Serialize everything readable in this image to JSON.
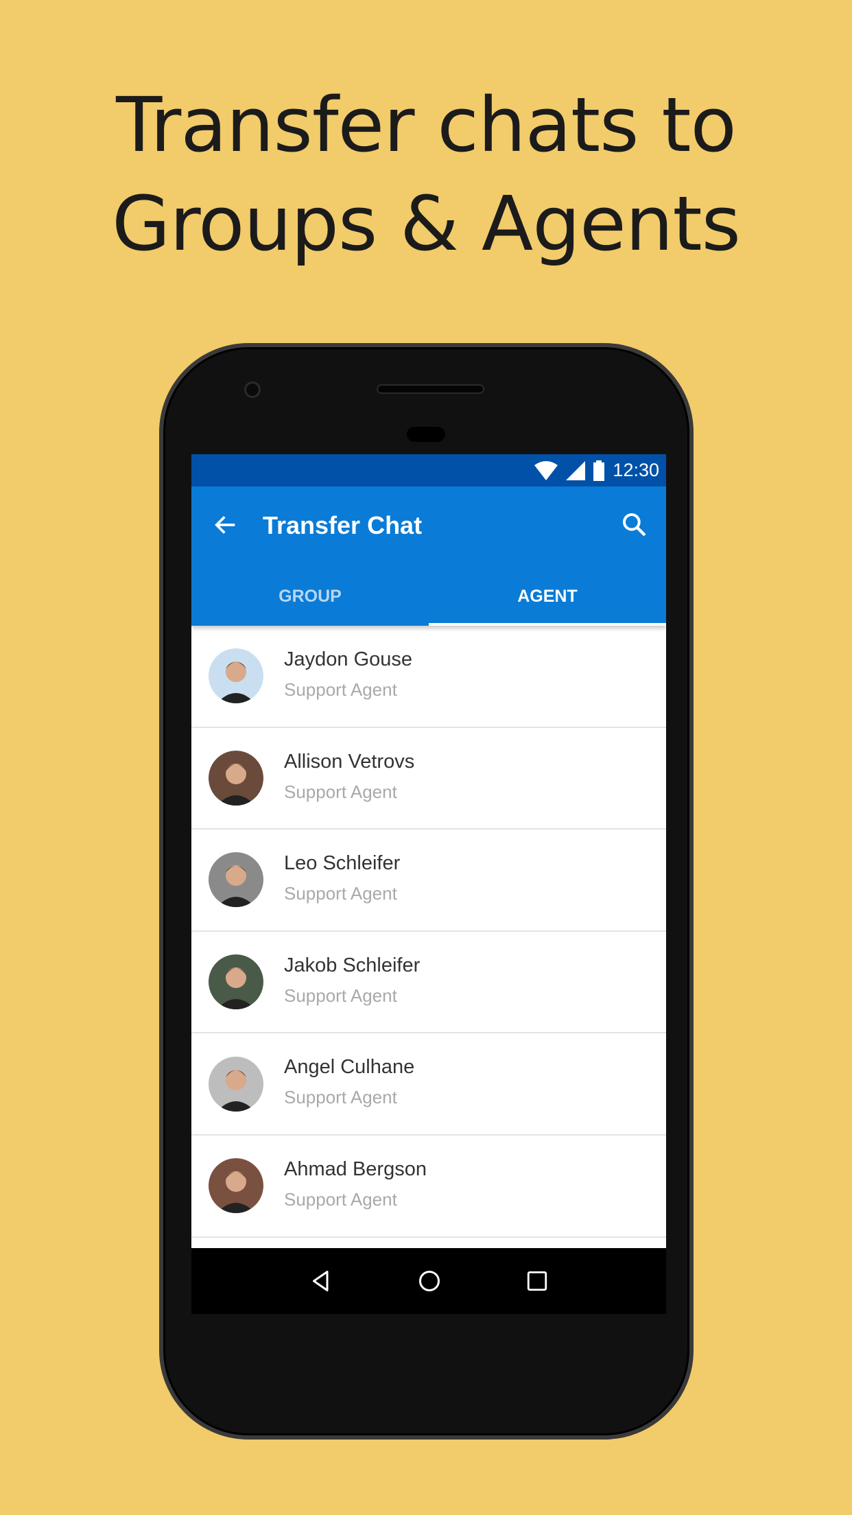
{
  "headline": {
    "line1": "Transfer chats to",
    "line2": "Groups & Agents"
  },
  "colors": {
    "background": "#F2CB6A",
    "status_bar": "#0151A8",
    "app_bar": "#0A7BD6"
  },
  "status_bar": {
    "time": "12:30",
    "icons": [
      "wifi-icon",
      "signal-icon",
      "battery-icon"
    ]
  },
  "toolbar": {
    "title": "Transfer Chat",
    "back_icon": "arrow-left-icon",
    "search_icon": "search-icon"
  },
  "tabs": [
    {
      "label": "GROUP",
      "active": false
    },
    {
      "label": "AGENT",
      "active": true
    }
  ],
  "agents": [
    {
      "name": "Jaydon Gouse",
      "role": "Support Agent",
      "avatar_color": "#c9def0"
    },
    {
      "name": "Allison Vetrovs",
      "role": "Support Agent",
      "avatar_color": "#6a4a3a"
    },
    {
      "name": "Leo Schleifer",
      "role": "Support Agent",
      "avatar_color": "#8a8a8a"
    },
    {
      "name": "Jakob Schleifer",
      "role": "Support Agent",
      "avatar_color": "#4a5a48"
    },
    {
      "name": "Angel Culhane",
      "role": "Support Agent",
      "avatar_color": "#bdbdbd"
    },
    {
      "name": "Ahmad Bergson",
      "role": "Support Agent",
      "avatar_color": "#7a5040"
    }
  ],
  "nav_bar": {
    "icons": [
      "back-triangle-icon",
      "home-circle-icon",
      "recents-square-icon"
    ]
  }
}
